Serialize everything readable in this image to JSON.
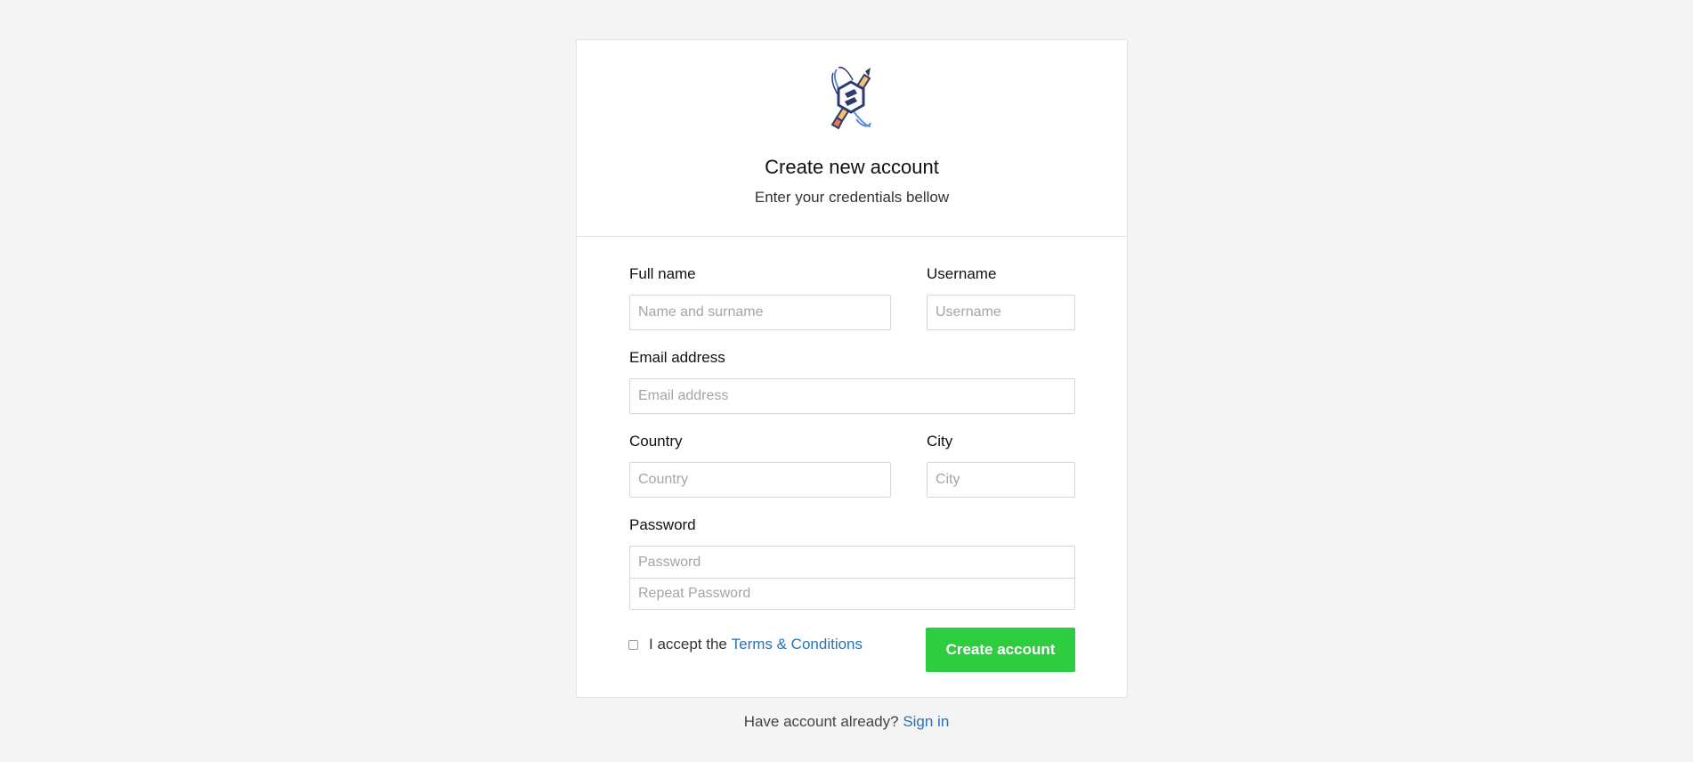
{
  "header": {
    "title": "Create new account",
    "subtitle": "Enter your credentials bellow",
    "logo_icon": "rocket-pencil-logo"
  },
  "form": {
    "full_name": {
      "label": "Full name",
      "placeholder": "Name and surname",
      "value": ""
    },
    "username": {
      "label": "Username",
      "placeholder": "Username",
      "value": ""
    },
    "email": {
      "label": "Email address",
      "placeholder": "Email address",
      "value": ""
    },
    "country": {
      "label": "Country",
      "placeholder": "Country",
      "value": ""
    },
    "city": {
      "label": "City",
      "placeholder": "City",
      "value": ""
    },
    "password": {
      "label": "Password",
      "placeholder": "Password",
      "repeat_placeholder": "Repeat Password",
      "value": ""
    },
    "terms": {
      "prefix": "I accept the",
      "link": "Terms & Conditions",
      "checked": false
    },
    "submit_label": "Create account"
  },
  "footer": {
    "prompt": "Have account already?",
    "signin_link": "Sign in"
  },
  "colors": {
    "background": "#f4f4f4",
    "primary_button": "#2ecc40",
    "link": "#2a72b5"
  }
}
